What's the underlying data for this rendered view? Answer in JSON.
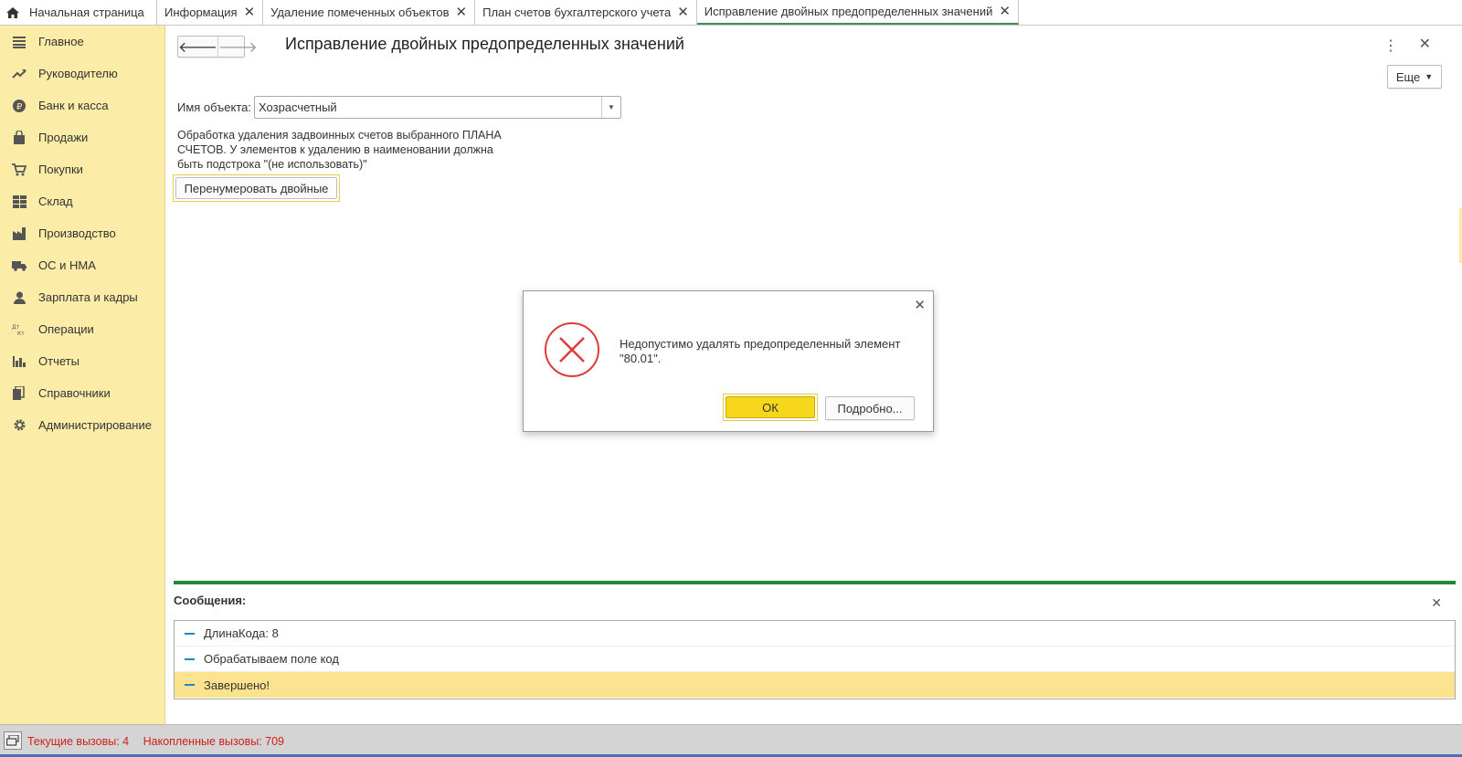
{
  "tabs": [
    {
      "label": "Начальная страница",
      "closable": false,
      "active": false,
      "icon": "home-icon"
    },
    {
      "label": "Информация",
      "closable": true,
      "active": false
    },
    {
      "label": "Удаление помеченных объектов",
      "closable": true,
      "active": false
    },
    {
      "label": "План счетов бухгалтерского учета",
      "closable": true,
      "active": false
    },
    {
      "label": "Исправление двойных предопределенных значений",
      "closable": true,
      "active": true
    }
  ],
  "sidebar": {
    "items": [
      {
        "label": "Главное",
        "icon": "menu-lines-icon"
      },
      {
        "label": "Руководителю",
        "icon": "trend-up-icon"
      },
      {
        "label": "Банк и касса",
        "icon": "ruble-coin-icon"
      },
      {
        "label": "Продажи",
        "icon": "shopping-bag-icon"
      },
      {
        "label": "Покупки",
        "icon": "cart-icon"
      },
      {
        "label": "Склад",
        "icon": "warehouse-grid-icon"
      },
      {
        "label": "Производство",
        "icon": "factory-icon"
      },
      {
        "label": "ОС и НМА",
        "icon": "truck-icon"
      },
      {
        "label": "Зарплата и кадры",
        "icon": "person-icon"
      },
      {
        "label": "Операции",
        "icon": "dt-kt-icon"
      },
      {
        "label": "Отчеты",
        "icon": "bar-chart-icon"
      },
      {
        "label": "Справочники",
        "icon": "books-icon"
      },
      {
        "label": "Администрирование",
        "icon": "gear-icon"
      }
    ]
  },
  "form": {
    "title": "Исправление двойных предопределенных значений",
    "more_label": "Еще",
    "object_label": "Имя объекта:",
    "object_value": "Хозрасчетный",
    "description": "Обработка удаления задвоинных счетов выбранного ПЛАНА СЧЕТОВ. У элементов к удалению в наименовании должна быть подстрока \"(не использовать)\"",
    "renumber_button": "Перенумеровать двойные"
  },
  "messages": {
    "title": "Сообщения:",
    "items": [
      "ДлинаКода: 8",
      "Обрабатываем поле код",
      "Завершено!"
    ]
  },
  "dialog": {
    "text": "Недопустимо удалять предопределенный элемент \"80.01\".",
    "ok_label": "ОК",
    "details_label": "Подробно..."
  },
  "statusbar": {
    "current_calls": "Текущие вызовы: 4",
    "accumulated_calls": "Накопленные вызовы: 709"
  },
  "colors": {
    "sidebar_bg": "#fbeca8",
    "accent_green": "#1d8a3a",
    "ok_button": "#f7d71b",
    "error_red": "#e03a3a",
    "status_red": "#d0201a"
  }
}
